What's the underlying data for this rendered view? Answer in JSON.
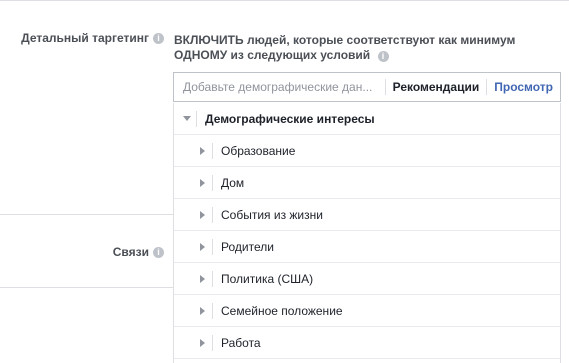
{
  "detailed_targeting": {
    "label": "Детальный таргетинг",
    "headline": "ВКЛЮЧИТЬ людей, которые соответствуют как минимум ОДНОМУ из следующих условий"
  },
  "connections": {
    "label": "Связи"
  },
  "search": {
    "placeholder": "Добавьте демографические дан...",
    "recommendations": "Рекомендации",
    "browse": "Просмотр"
  },
  "browse_tree": {
    "category": "Демографические интересы",
    "items": [
      "Образование",
      "Дом",
      "События из жизни",
      "Родители",
      "Политика (США)",
      "Семейное положение",
      "Работа"
    ]
  },
  "colors": {
    "accent": "#4267b2",
    "border": "#dddfe2",
    "label": "#4b4f56"
  }
}
